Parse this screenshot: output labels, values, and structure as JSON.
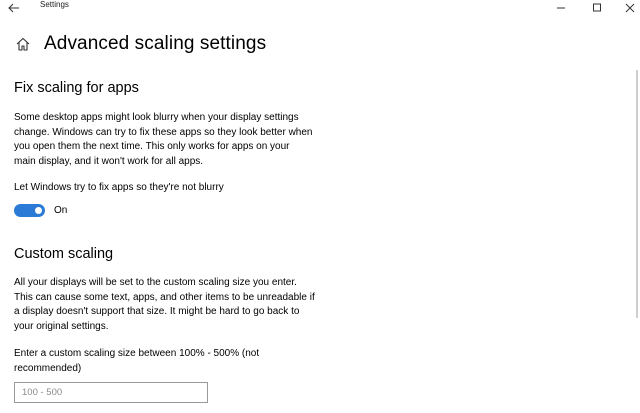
{
  "window": {
    "title": "Settings"
  },
  "page": {
    "title": "Advanced scaling settings"
  },
  "fix_scaling": {
    "heading": "Fix scaling for apps",
    "description_lines": [
      "Some desktop apps might look blurry when your display settings",
      "change. Windows can try to fix these apps so they look better when",
      "you open them the next time. This only works for apps on your",
      "main display, and it won't work for all apps."
    ],
    "toggle_label": "Let Windows try to fix apps so they're not blurry",
    "toggle_state": "On",
    "toggle_on": true,
    "accent_color": "#2b7bd6"
  },
  "custom_scaling": {
    "heading": "Custom scaling",
    "description_lines": [
      "All your displays will be set to the custom scaling size you enter.",
      "This can cause some text, apps, and other items to be unreadable if",
      "a display doesn't support that size. It might be hard to go back to",
      "your original settings."
    ],
    "input_label_lines": [
      "Enter a custom scaling size between 100% - 500% (not",
      "recommended)"
    ],
    "input_placeholder": "100 - 500",
    "input_value": ""
  },
  "icons": {
    "back": "back-arrow-icon",
    "home": "home-icon",
    "minimize": "minimize-icon",
    "maximize": "maximize-icon",
    "close": "close-icon"
  }
}
